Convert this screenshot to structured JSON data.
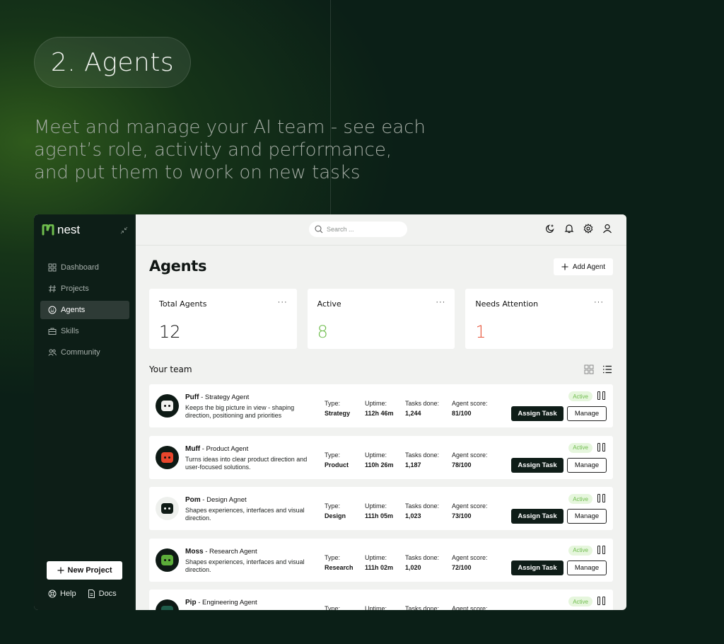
{
  "hero": {
    "pill": "2. Agents",
    "intro_lines": [
      "Meet and manage your AI team - see each",
      "agent’s role, activity and performance,",
      "and put them to work on new tasks"
    ]
  },
  "brand": {
    "name": "nest",
    "accent": "#6fbd4d"
  },
  "sidebar": {
    "items": [
      {
        "label": "Dashboard",
        "icon": "grid-icon"
      },
      {
        "label": "Projects",
        "icon": "hash-icon"
      },
      {
        "label": "Agents",
        "icon": "smile-icon",
        "active": true
      },
      {
        "label": "Skills",
        "icon": "briefcase-icon"
      },
      {
        "label": "Community",
        "icon": "users-icon"
      }
    ],
    "new_project": "New Project",
    "help": "Help",
    "docs": "Docs"
  },
  "topbar": {
    "search_placeholder": "Search ..."
  },
  "page": {
    "title": "Agents",
    "add_agent": "Add Agent"
  },
  "stats": [
    {
      "label": "Total Agents",
      "value": "12",
      "color": "#111111"
    },
    {
      "label": "Active",
      "value": "8",
      "color": "#6fbd4d"
    },
    {
      "label": "Needs Attention",
      "value": "1",
      "color": "#e8553a"
    }
  ],
  "team": {
    "title": "Your team",
    "col_labels": {
      "type": "Type:",
      "uptime": "Uptime:",
      "tasks": "Tasks done:",
      "score": "Agent score:"
    },
    "assign_label": "Assign Task",
    "manage_label": "Manage",
    "agents": [
      {
        "name": "Puff",
        "role": " - Strategy Agent",
        "desc": "Keeps the big picture in view - shaping direction, positioning and priorities",
        "type": "Strategy",
        "uptime": "112h 46m",
        "tasks": "1,244",
        "score": "81/100",
        "status": "Active",
        "face_color": "#f2f2f0",
        "light": false
      },
      {
        "name": "Muff",
        "role": " - Product Agent",
        "desc": "Turns ideas into clear product direction and user-focused solutions.",
        "type": "Product",
        "uptime": "110h 26m",
        "tasks": "1,187",
        "score": "78/100",
        "status": "Active",
        "face_color": "#e8462c",
        "light": false
      },
      {
        "name": "Pom",
        "role": " - Design Agnet",
        "desc": "Shapes experiences, interfaces and visual direction.",
        "type": "Design",
        "uptime": "111h 05m",
        "tasks": "1,023",
        "score": "73/100",
        "status": "Active",
        "face_color": "#0e1a15",
        "light": true
      },
      {
        "name": "Moss",
        "role": " - Research Agent",
        "desc": "Shapes experiences, interfaces and visual direction.",
        "type": "Research",
        "uptime": "111h 02m",
        "tasks": "1,020",
        "score": "72/100",
        "status": "Active",
        "face_color": "#5cae3a",
        "light": false
      },
      {
        "name": "Pip",
        "role": " - Engineering Agent",
        "desc": "",
        "type": "",
        "uptime": "",
        "tasks": "",
        "score": "",
        "status": "Active",
        "face_color": "#1f5c4a",
        "light": false
      }
    ]
  }
}
